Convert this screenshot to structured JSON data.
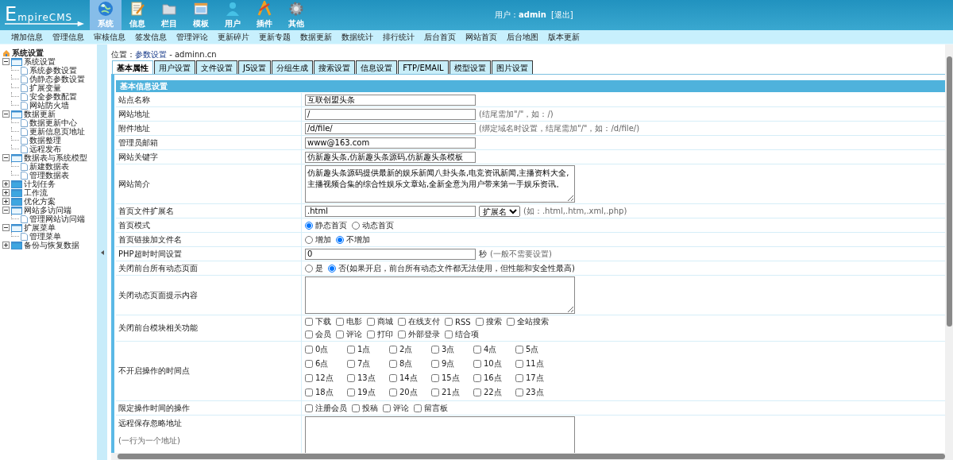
{
  "header": {
    "logo_initial": "E",
    "logo_rest": "mpireCMS",
    "modules": [
      {
        "label": "系统",
        "selected": true
      },
      {
        "label": "信息",
        "selected": false
      },
      {
        "label": "栏目",
        "selected": false
      },
      {
        "label": "模板",
        "selected": false
      },
      {
        "label": "用户",
        "selected": false
      },
      {
        "label": "插件",
        "selected": false
      },
      {
        "label": "其他",
        "selected": false
      }
    ],
    "user_label": "用户：",
    "user_name": "admin",
    "logout": "[退出]"
  },
  "nav": [
    "增加信息",
    "管理信息",
    "审核信息",
    "签发信息",
    "管理评论",
    "更新碎片",
    "更新专题",
    "数据更新",
    "数据统计",
    "排行统计",
    "后台首页",
    "网站首页",
    "后台地图",
    "版本更新"
  ],
  "sidebar": {
    "title": "系统设置",
    "tree": [
      {
        "label": "系统设置",
        "expanded": true,
        "children": [
          {
            "label": "系统参数设置"
          },
          {
            "label": "伪静态参数设置"
          },
          {
            "label": "扩展变量"
          },
          {
            "label": "安全参数配置"
          },
          {
            "label": "网站防火墙"
          }
        ]
      },
      {
        "label": "数据更新",
        "expanded": true,
        "children": [
          {
            "label": "数据更新中心"
          },
          {
            "label": "更新信息页地址"
          },
          {
            "label": "数据整理"
          },
          {
            "label": "远程发布"
          }
        ]
      },
      {
        "label": "数据表与系统模型",
        "expanded": true,
        "children": [
          {
            "label": "新建数据表"
          },
          {
            "label": "管理数据表"
          }
        ]
      },
      {
        "label": "计划任务",
        "expanded": false
      },
      {
        "label": "工作流",
        "expanded": false
      },
      {
        "label": "优化方案",
        "expanded": false
      },
      {
        "label": "网站多访问端",
        "expanded": true,
        "children": [
          {
            "label": "管理网站访问端"
          }
        ]
      },
      {
        "label": "扩展菜单",
        "expanded": true,
        "children": [
          {
            "label": "管理菜单"
          }
        ]
      },
      {
        "label": "备份与恢复数据",
        "expanded": false
      }
    ]
  },
  "location": {
    "label": "位置：",
    "link": "参数设置",
    "rest": " - adminn.cn"
  },
  "tabs": [
    {
      "label": "基本属性",
      "selected": true
    },
    {
      "label": "用户设置",
      "selected": false
    },
    {
      "label": "文件设置",
      "selected": false
    },
    {
      "label": "JS设置",
      "selected": false
    },
    {
      "label": "分组生成",
      "selected": false
    },
    {
      "label": "搜索设置",
      "selected": false
    },
    {
      "label": "信息设置",
      "selected": false
    },
    {
      "label": "FTP/EMAIL",
      "selected": false
    },
    {
      "label": "模型设置",
      "selected": false
    },
    {
      "label": "图片设置",
      "selected": false
    }
  ],
  "section_title": "基本信息设置",
  "rows": [
    {
      "kind": "text",
      "label": "站点名称",
      "value": "互联创盟头条"
    },
    {
      "kind": "text",
      "label": "网站地址",
      "value": "/",
      "hint": "(结尾需加\"/\"，如：/)"
    },
    {
      "kind": "text",
      "label": "附件地址",
      "value": "/d/file/",
      "hint": "(绑定域名时设置，结尾需加\"/\"，如：/d/file/)"
    },
    {
      "kind": "text",
      "label": "管理员邮箱",
      "value": "www@163.com"
    },
    {
      "kind": "text",
      "label": "网站关键字",
      "value": "仿新趣头条,仿新趣头条源码,仿新趣头条模板"
    },
    {
      "kind": "textarea",
      "label": "网站简介",
      "value": "仿新趣头条源码提供最新的娱乐新闻八卦头条,电竞资讯新闻,主播资料大全,主播视频合集的综合性娱乐文章站,全新全意为用户带来第一手娱乐资讯。"
    },
    {
      "kind": "text",
      "label": "首页文件扩展名",
      "value": ".html",
      "select": "扩展名",
      "hint": "(如：.html,.htm,.xml,.php)"
    },
    {
      "kind": "radio",
      "label": "首页模式",
      "options": [
        {
          "label": "静态首页",
          "selected": true
        },
        {
          "label": "动态首页",
          "selected": false
        }
      ]
    },
    {
      "kind": "radio",
      "label": "首页链接加文件名",
      "options": [
        {
          "label": "增加",
          "selected": false
        },
        {
          "label": "不增加",
          "selected": true
        }
      ]
    },
    {
      "kind": "text",
      "label": "PHP超时时间设置",
      "value": "0",
      "suffix": "秒",
      "hint": "(一般不需要设置)"
    },
    {
      "kind": "radio",
      "label": "关闭前台所有动态页面",
      "options": [
        {
          "label": "是",
          "selected": false
        },
        {
          "label": "否(如果开启，前台所有动态文件都无法使用，但性能和安全性最高)",
          "selected": true
        }
      ]
    },
    {
      "kind": "textarea",
      "label": "关闭动态页面提示内容",
      "value": ""
    },
    {
      "kind": "checks",
      "label": "关闭前台模块相关功能",
      "options": [
        {
          "label": "下载",
          "checked": false
        },
        {
          "label": "电影",
          "checked": false
        },
        {
          "label": "商城",
          "checked": false
        },
        {
          "label": "在线支付",
          "checked": false
        },
        {
          "label": "RSS",
          "checked": false
        },
        {
          "label": "搜索",
          "checked": false
        },
        {
          "label": "全站搜索",
          "checked": false
        },
        {
          "label": "会员",
          "checked": false
        },
        {
          "label": "评论",
          "checked": false
        },
        {
          "label": "打印",
          "checked": false
        },
        {
          "label": "外部登录",
          "checked": false
        },
        {
          "label": "结合项",
          "checked": false
        }
      ]
    },
    {
      "kind": "grid",
      "label": "不开启操作的时间点",
      "options": [
        {
          "label": "0点",
          "checked": false
        },
        {
          "label": "1点",
          "checked": false
        },
        {
          "label": "2点",
          "checked": false
        },
        {
          "label": "3点",
          "checked": false
        },
        {
          "label": "4点",
          "checked": false
        },
        {
          "label": "5点",
          "checked": false
        },
        {
          "label": "6点",
          "checked": false
        },
        {
          "label": "7点",
          "checked": false
        },
        {
          "label": "8点",
          "checked": false
        },
        {
          "label": "9点",
          "checked": false
        },
        {
          "label": "10点",
          "checked": false
        },
        {
          "label": "11点",
          "checked": false
        },
        {
          "label": "12点",
          "checked": false
        },
        {
          "label": "13点",
          "checked": false
        },
        {
          "label": "14点",
          "checked": false
        },
        {
          "label": "15点",
          "checked": false
        },
        {
          "label": "16点",
          "checked": false
        },
        {
          "label": "17点",
          "checked": false
        },
        {
          "label": "18点",
          "checked": false
        },
        {
          "label": "19点",
          "checked": false
        },
        {
          "label": "20点",
          "checked": false
        },
        {
          "label": "21点",
          "checked": false
        },
        {
          "label": "22点",
          "checked": false
        },
        {
          "label": "23点",
          "checked": false
        }
      ]
    },
    {
      "kind": "checks",
      "label": "限定操作时间的操作",
      "options": [
        {
          "label": "注册会员",
          "checked": false
        },
        {
          "label": "投稿",
          "checked": false
        },
        {
          "label": "评论",
          "checked": false
        },
        {
          "label": "留言板",
          "checked": false
        }
      ]
    },
    {
      "kind": "textarea",
      "label": "远程保存忽略地址",
      "note": "(一行为一个地址)",
      "value": ""
    }
  ]
}
